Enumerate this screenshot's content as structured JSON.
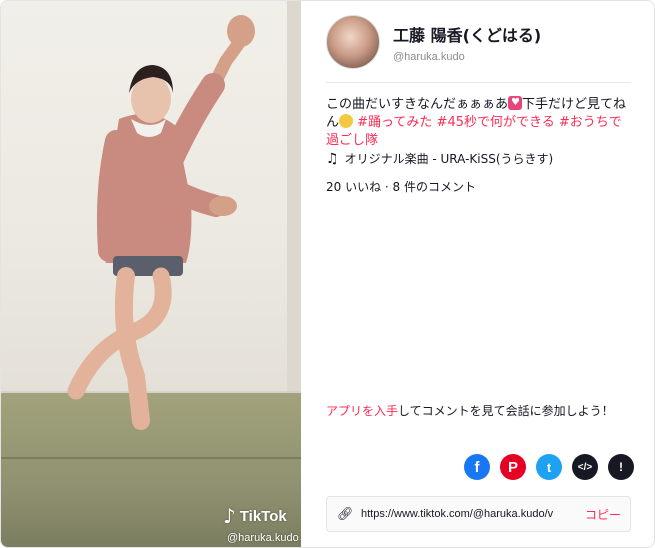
{
  "author": {
    "name": "工藤 陽香(くどはる)",
    "handle": "@haruka.kudo"
  },
  "caption": {
    "text_1": "この曲だいすきなんだぁぁぁあ",
    "text_2": "下手だけど見てね",
    "text_3": "ん",
    "hashtags": [
      "#踊ってみた",
      "#45秒で何ができる",
      "#おうちで過ごし隊"
    ]
  },
  "music": {
    "label": "オリジナル楽曲 - URA-KiSS(うらきす)"
  },
  "stats": {
    "text": "20 いいね · 8 件のコメント"
  },
  "cta": {
    "link": "アプリを入手",
    "rest": "してコメントを見て会話に参加しよう！"
  },
  "share": {
    "facebook": "f",
    "pinterest": "P",
    "twitter": "t",
    "embed": "</>",
    "report": "!"
  },
  "link_box": {
    "url": "https://www.tiktok.com/@haruka.kudo/v",
    "copy_label": "コピー"
  },
  "video": {
    "brand": "TikTok",
    "watermark_handle": "@haruka.kudo"
  },
  "colors": {
    "accent": "#fe2c55",
    "facebook": "#1877f2",
    "pinterest": "#e60023",
    "twitter": "#1da1f2"
  }
}
